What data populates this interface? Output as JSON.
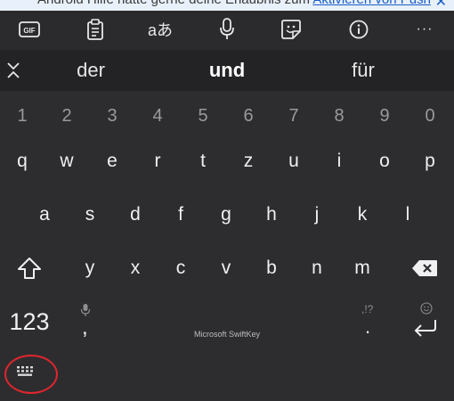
{
  "notification": {
    "text": "Android Hilfe hätte gerne deine Erlaubnis zum ",
    "link": "Aktivieren von Push"
  },
  "toolbar": {
    "gif_label": "GIF",
    "translate_label": "aあ",
    "more_label": "···"
  },
  "suggestions": {
    "left": "der",
    "center": "und",
    "right": "für"
  },
  "keyboard": {
    "numbers": [
      "1",
      "2",
      "3",
      "4",
      "5",
      "6",
      "7",
      "8",
      "9",
      "0"
    ],
    "row1": [
      "q",
      "w",
      "e",
      "r",
      "t",
      "z",
      "u",
      "i",
      "o",
      "p"
    ],
    "row2": [
      "a",
      "s",
      "d",
      "f",
      "g",
      "h",
      "j",
      "k",
      "l"
    ],
    "row3": [
      "y",
      "x",
      "c",
      "v",
      "b",
      "n",
      "m"
    ],
    "numbers_key_label": "123",
    "comma_label": ",",
    "period_label": ".",
    "punct_hint": ",!?",
    "space_label": "Microsoft SwiftKey"
  },
  "colors": {
    "background": "#2d2d30",
    "highlight_circle": "#e0262c"
  }
}
